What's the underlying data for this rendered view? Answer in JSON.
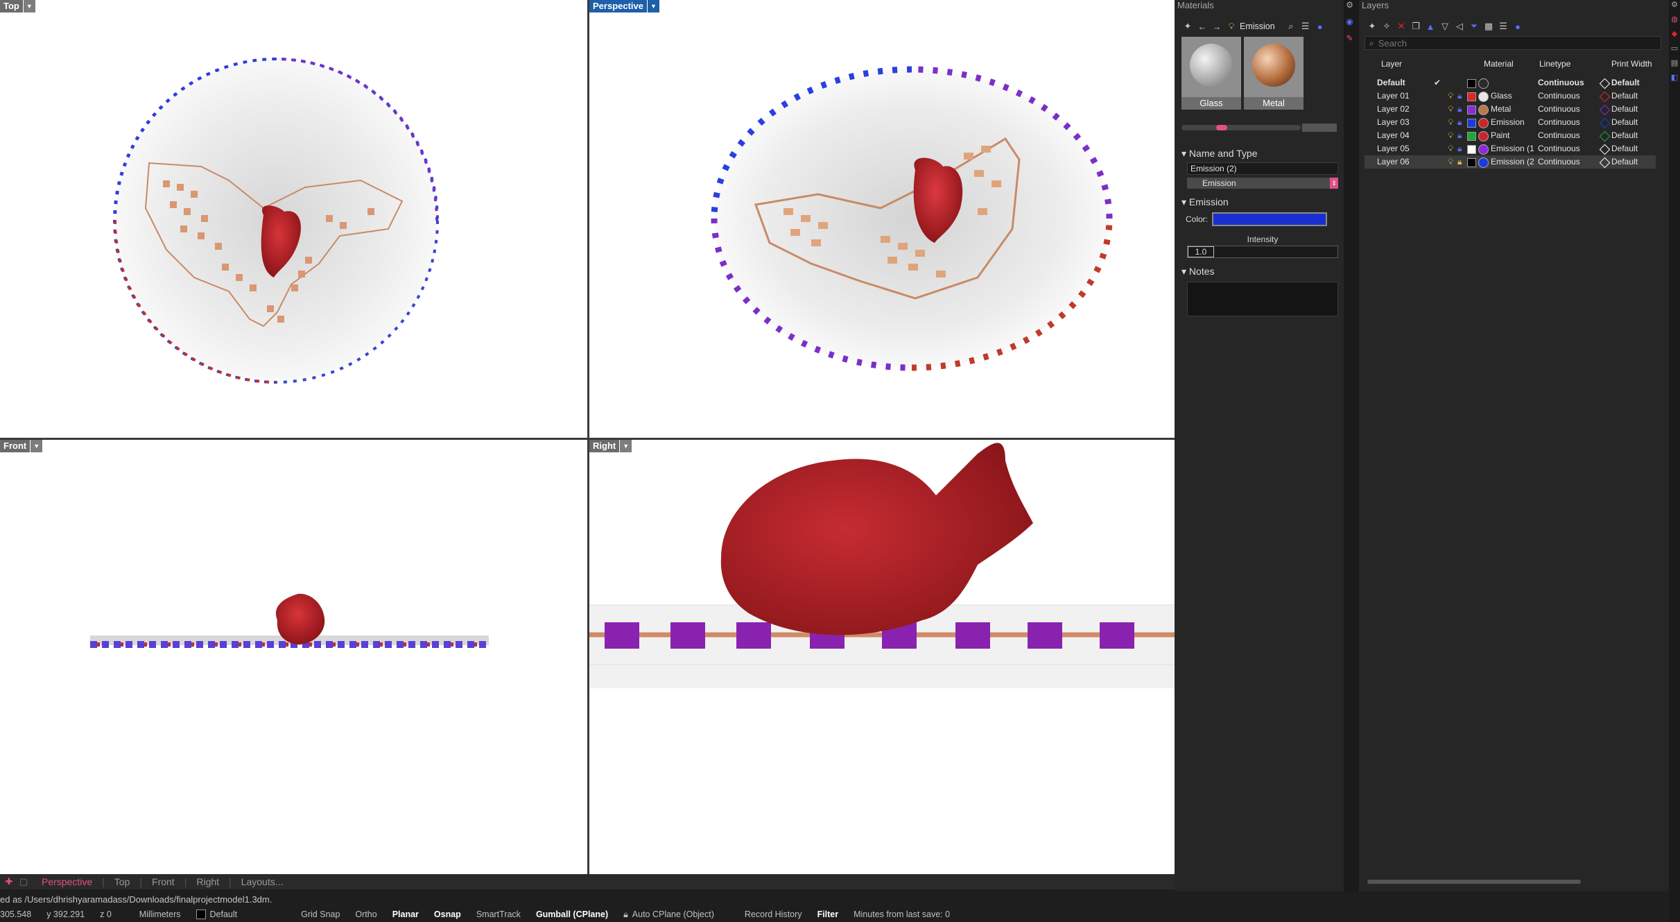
{
  "viewports": {
    "top": {
      "label": "Top"
    },
    "perspective": {
      "label": "Perspective"
    },
    "front": {
      "label": "Front"
    },
    "right": {
      "label": "Right"
    }
  },
  "view_tabs": [
    "Perspective",
    "Top",
    "Front",
    "Right",
    "Layouts..."
  ],
  "command_line": "ed as /Users/dhrishyaramadass/Downloads/finalprojectmodel1.3dm.",
  "status": {
    "x": "305.548",
    "y": "y 392.291",
    "z": "z 0",
    "units": "Millimeters",
    "layer": "Default",
    "grid_snap": "Grid Snap",
    "ortho": "Ortho",
    "planar": "Planar",
    "osnap": "Osnap",
    "smarttrack": "SmartTrack",
    "gumball": "Gumball (CPlane)",
    "auto_cplane": "Auto CPlane (Object)",
    "record_history": "Record History",
    "filter": "Filter",
    "last_save": "Minutes from last save: 0"
  },
  "materials": {
    "title": "Materials",
    "current": "Emission",
    "thumbs": [
      {
        "label": "Glass"
      },
      {
        "label": "Metal"
      }
    ],
    "name_and_type_header": "Name and Type",
    "name_value": "Emission (2)",
    "type_value": "Emission",
    "emission_header": "Emission",
    "color_label": "Color:",
    "color_value": "#1a2fd0",
    "intensity_label": "Intensity",
    "intensity_value": "1.0",
    "notes_header": "Notes"
  },
  "layers": {
    "title": "Layers",
    "search_placeholder": "Search",
    "columns": {
      "layer": "Layer",
      "material": "Material",
      "linetype": "Linetype",
      "print_width": "Print Width"
    },
    "rows": [
      {
        "name": "Default",
        "material": "",
        "linetype": "Continuous",
        "print_width": "Default",
        "color": "#000000",
        "mat_color": "#2a2a2a",
        "pw_color": "#ffffff",
        "current": true
      },
      {
        "name": "Layer 01",
        "material": "Glass",
        "linetype": "Continuous",
        "print_width": "Default",
        "color": "#e0262b",
        "mat_color": "#e8e8e8",
        "pw_color": "#e0262b"
      },
      {
        "name": "Layer 02",
        "material": "Metal",
        "linetype": "Continuous",
        "print_width": "Default",
        "color": "#8a2bd8",
        "mat_color": "#b97a4a",
        "pw_color": "#8a2bd8"
      },
      {
        "name": "Layer 03",
        "material": "Emission",
        "linetype": "Continuous",
        "print_width": "Default",
        "color": "#1a3be0",
        "mat_color": "#c8262b",
        "pw_color": "#1a3be0"
      },
      {
        "name": "Layer 04",
        "material": "Paint",
        "linetype": "Continuous",
        "print_width": "Default",
        "color": "#22a63a",
        "mat_color": "#c8262b",
        "pw_color": "#22a63a"
      },
      {
        "name": "Layer 05",
        "material": "Emission (1",
        "linetype": "Continuous",
        "print_width": "Default",
        "color": "#ffffff",
        "mat_color": "#8a2bd8",
        "pw_color": "#ffffff"
      },
      {
        "name": "Layer 06",
        "material": "Emission (2",
        "linetype": "Continuous",
        "print_width": "Default",
        "color": "#000000",
        "mat_color": "#1a3be0",
        "pw_color": "#ffffff",
        "selected": true
      }
    ]
  }
}
